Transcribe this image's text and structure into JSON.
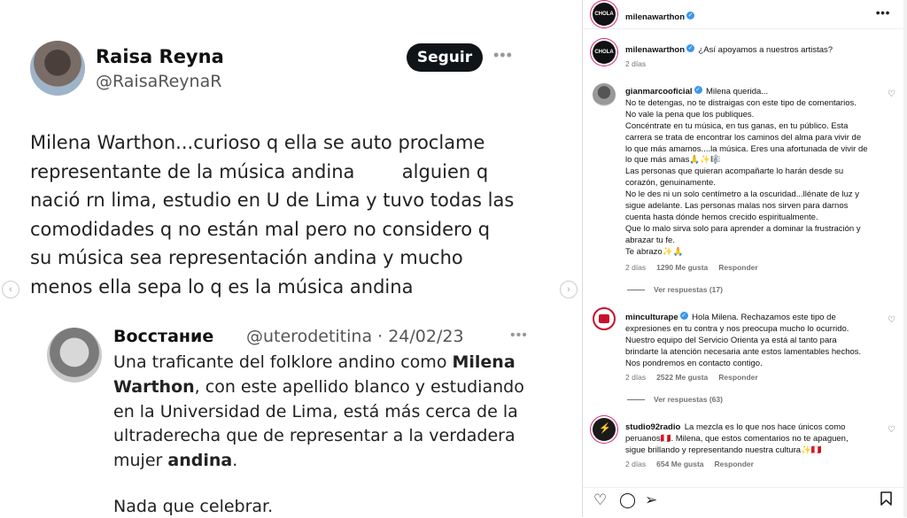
{
  "post_image": {
    "author_name": "Raisa Reyna",
    "author_handle": "@RaisaReynaR",
    "follow_label": "Seguir",
    "more_icon": "ellipsis-icon",
    "tweet_lines": [
      "Milena Warthon...curioso q ella se auto proclame",
      "representante de la música andina        alguien q",
      "nació rn lima, estudio en U de Lima y tuvo todas las",
      "comodidades q no están mal pero no considero q",
      "su música sea representación andina y mucho",
      "menos ella sepa lo q es la música andina"
    ],
    "quote": {
      "name": "Восстание",
      "handle_date": "@uterodetitina · 24/02/23",
      "line1a": "Una traficante del folklore andino como ",
      "line1b": "Milena",
      "line2a": "Warthon",
      "line2b": ", con este apellido blanco y estudiando",
      "line3": "en la Universidad de Lima, está más cerca de la",
      "line4": "ultraderecha que de representar a la verdadera",
      "line5a": "mujer ",
      "line5b": "andina",
      "line5c": ".",
      "line6": "Nada que celebrar."
    }
  },
  "panel": {
    "header_user": "milenawarthon",
    "header_avatar_text": "CHOLA",
    "header_more": "•••",
    "caption": {
      "user": "milenawarthon",
      "text": "¿Así apoyamos a nuestros artistas?",
      "time": "2 días"
    },
    "comments": [
      {
        "user": "gianmarcooficial",
        "lines": [
          "Milena querida...",
          "No te detengas, no te distraigas con este tipo de comentarios.",
          "No vale la pena que los publiques.",
          "Concéntrate en tu música, en tus ganas, en tu público. Esta",
          "carrera se trata de encontrar los caminos del alma para vivir de",
          "lo que más amamos....la música. Eres una afortunada de vivir de",
          "lo que más amas🙏✨🎼",
          "Las personas que quieran acompañarte lo harán desde su",
          "corazón, genuinamente.",
          "No le des ni un solo centímetro a la oscuridad...llénate de luz y",
          "sigue adelante. Las personas malas nos sirven para darnos",
          "cuenta hasta dónde hemos crecido espiritualmente.",
          "Que lo malo sirva solo para aprender a dominar la frustración y",
          "abrazar tu fe.",
          "Te abrazo✨🙏"
        ],
        "time": "2 días",
        "likes": "1290 Me gusta",
        "reply": "Responder",
        "view_replies": "Ver respuestas (17)"
      },
      {
        "user": "minculturape",
        "lines": [
          "Hola Milena. Rechazamos este tipo de",
          "expresiones en tu contra y nos preocupa mucho lo ocurrido.",
          "Nuestro equipo del Servicio Orienta ya está al tanto para",
          "brindarte la atención necesaria ante estos lamentables hechos.",
          "Nos pondremos en contacto contigo."
        ],
        "time": "2 días",
        "likes": "2522 Me gusta",
        "reply": "Responder",
        "view_replies": "Ver respuestas (63)"
      },
      {
        "user": "studio92radio",
        "lines": [
          "La mezcla es lo que nos hace únicos como",
          "peruanos🇵🇪. Milena, que estos comentarios no te apaguen,",
          "sigue brillando y representando nuestra cultura✨🇵🇪"
        ],
        "time": "2 días",
        "likes": "654 Me gusta",
        "reply": "Responder"
      }
    ],
    "action_icons": [
      "heart-icon",
      "comment-icon",
      "share-icon",
      "bookmark-icon"
    ]
  }
}
